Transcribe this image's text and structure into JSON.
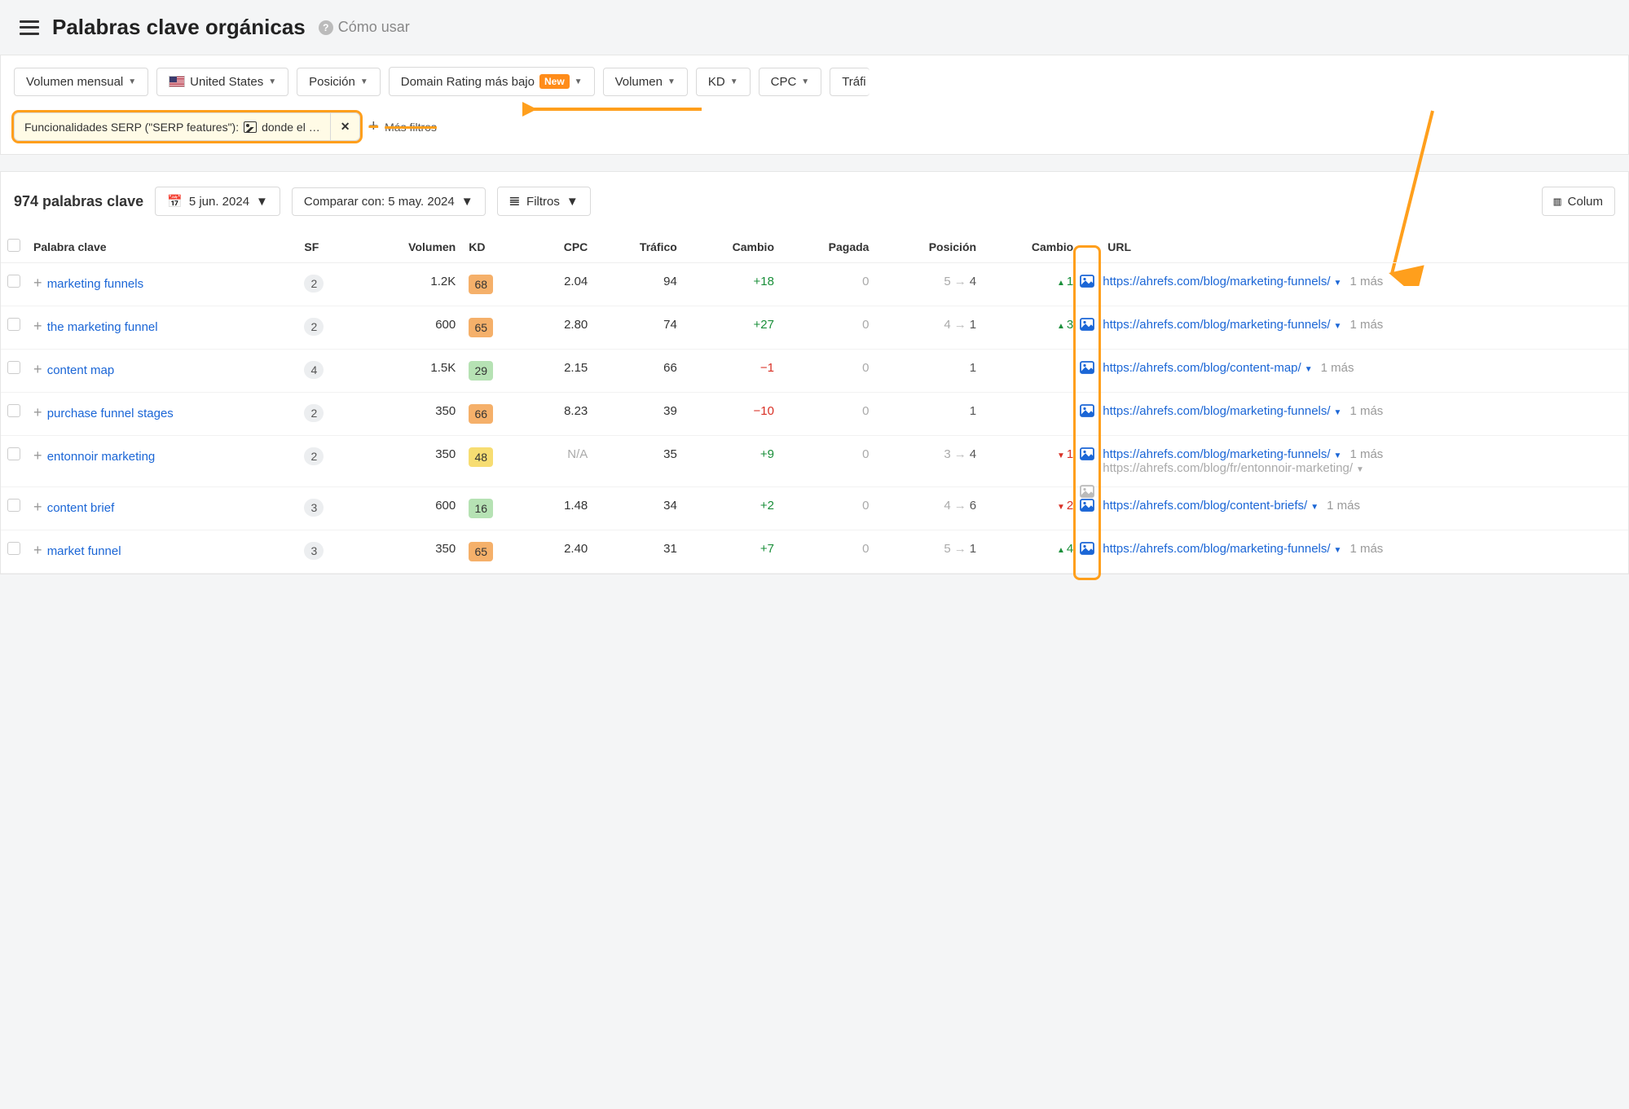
{
  "header": {
    "title": "Palabras clave orgánicas",
    "how_to": "Cómo usar"
  },
  "filters": {
    "monthly_volume": "Volumen mensual",
    "country": "United States",
    "position": "Posición",
    "dr_lowest": "Domain Rating más bajo",
    "new_badge": "New",
    "volume": "Volumen",
    "kd": "KD",
    "cpc": "CPC",
    "traffic": "Tráfi",
    "applied_chip_label": "Funcionalidades SERP (\"SERP features\"):",
    "applied_chip_value": "donde el …",
    "more_filters": "Más filtros"
  },
  "toolbar": {
    "count": "974 palabras clave",
    "date": "5 jun. 2024",
    "compare": "Comparar con: 5 may. 2024",
    "filters_btn": "Filtros",
    "columns_btn": "Colum"
  },
  "columns": {
    "keyword": "Palabra clave",
    "sf": "SF",
    "volume": "Volumen",
    "kd": "KD",
    "cpc": "CPC",
    "traffic": "Tráfico",
    "change": "Cambio",
    "paid": "Pagada",
    "position": "Posición",
    "pos_change": "Cambio",
    "url": "URL"
  },
  "common": {
    "more_suffix": "1 más"
  },
  "kd_colors": {
    "orange": "#f5b06a",
    "green": "#b6e2b4",
    "yellow": "#f7dd72"
  },
  "rows": [
    {
      "keyword": "marketing funnels",
      "sf": "2",
      "volume": "1.2K",
      "kd": "68",
      "kd_color": "orange",
      "cpc": "2.04",
      "traffic": "94",
      "change": "+18",
      "change_dir": "pos",
      "paid": "0",
      "pos_from": "5",
      "pos_to": "4",
      "rank_change": "1",
      "rank_dir": "up",
      "urls": [
        {
          "icon": "blue",
          "href": "https://ahrefs.com/blog/marketing-funnels/",
          "more": true
        }
      ]
    },
    {
      "keyword": "the marketing funnel",
      "sf": "2",
      "volume": "600",
      "kd": "65",
      "kd_color": "orange",
      "cpc": "2.80",
      "traffic": "74",
      "change": "+27",
      "change_dir": "pos",
      "paid": "0",
      "pos_from": "4",
      "pos_to": "1",
      "rank_change": "3",
      "rank_dir": "up",
      "urls": [
        {
          "icon": "blue",
          "href": "https://ahrefs.com/blog/marketing-funnels/",
          "more": true
        }
      ]
    },
    {
      "keyword": "content map",
      "sf": "4",
      "volume": "1.5K",
      "kd": "29",
      "kd_color": "green",
      "cpc": "2.15",
      "traffic": "66",
      "change": "−1",
      "change_dir": "neg",
      "paid": "0",
      "pos_from": "",
      "pos_to": "1",
      "rank_change": "",
      "rank_dir": "",
      "urls": [
        {
          "icon": "blue",
          "href": "https://ahrefs.com/blog/content-map/",
          "more": true
        }
      ]
    },
    {
      "keyword": "purchase funnel stages",
      "sf": "2",
      "volume": "350",
      "kd": "66",
      "kd_color": "orange",
      "cpc": "8.23",
      "traffic": "39",
      "change": "−10",
      "change_dir": "neg",
      "paid": "0",
      "pos_from": "",
      "pos_to": "1",
      "rank_change": "",
      "rank_dir": "",
      "urls": [
        {
          "icon": "blue",
          "href": "https://ahrefs.com/blog/marketing-funnels/",
          "more": true
        }
      ]
    },
    {
      "keyword": "entonnoir marketing",
      "sf": "2",
      "volume": "350",
      "kd": "48",
      "kd_color": "yellow",
      "cpc": "N/A",
      "traffic": "35",
      "change": "+9",
      "change_dir": "pos",
      "paid": "0",
      "pos_from": "3",
      "pos_to": "4",
      "rank_change": "1",
      "rank_dir": "down",
      "urls": [
        {
          "icon": "blue",
          "href": "https://ahrefs.com/blog/marketing-funnels/",
          "more": true
        },
        {
          "icon": "gray",
          "href": "https://ahrefs.com/blog/fr/entonnoir-marketing/",
          "more": false,
          "gray": true
        }
      ]
    },
    {
      "keyword": "content brief",
      "sf": "3",
      "volume": "600",
      "kd": "16",
      "kd_color": "green",
      "cpc": "1.48",
      "traffic": "34",
      "change": "+2",
      "change_dir": "pos",
      "paid": "0",
      "pos_from": "4",
      "pos_to": "6",
      "rank_change": "2",
      "rank_dir": "down",
      "urls": [
        {
          "icon": "blue",
          "href": "https://ahrefs.com/blog/content-briefs/",
          "more": true
        }
      ]
    },
    {
      "keyword": "market funnel",
      "sf": "3",
      "volume": "350",
      "kd": "65",
      "kd_color": "orange",
      "cpc": "2.40",
      "traffic": "31",
      "change": "+7",
      "change_dir": "pos",
      "paid": "0",
      "pos_from": "5",
      "pos_to": "1",
      "rank_change": "4",
      "rank_dir": "up",
      "urls": [
        {
          "icon": "blue",
          "href": "https://ahrefs.com/blog/marketing-funnels/",
          "more": true
        }
      ]
    }
  ]
}
